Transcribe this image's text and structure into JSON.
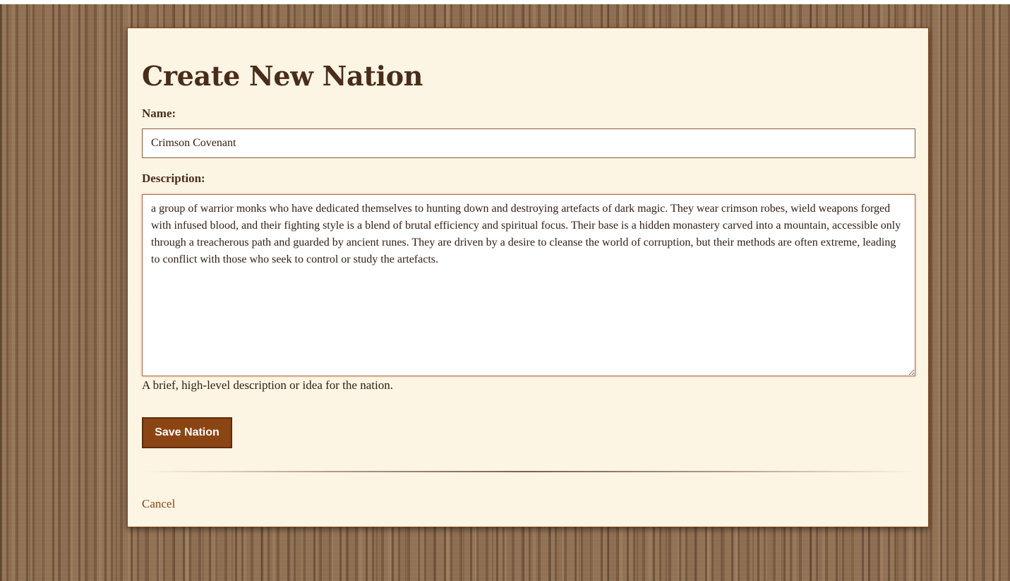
{
  "form": {
    "title": "Create New Nation",
    "name_label": "Name:",
    "name_value": "Crimson Covenant",
    "description_label": "Description:",
    "description_value": "a group of warrior monks who have dedicated themselves to hunting down and destroying artefacts of dark magic. They wear crimson robes, wield weapons forged with infused blood, and their fighting style is a blend of brutal efficiency and spiritual focus. Their base is a hidden monastery carved into a mountain, accessible only through a treacherous path and guarded by ancient runes. They are driven by a desire to cleanse the world of corruption, but their methods are often extreme, leading to conflict with those who seek to control or study the artefacts.",
    "description_help": "A brief, high-level description or idea for the nation.",
    "save_label": "Save Nation",
    "cancel_label": "Cancel"
  },
  "colors": {
    "accent": "#8b4513",
    "card_background": "#fdf5e4",
    "heading_text": "#4a2c1a",
    "page_background": "#8a6a4e"
  }
}
